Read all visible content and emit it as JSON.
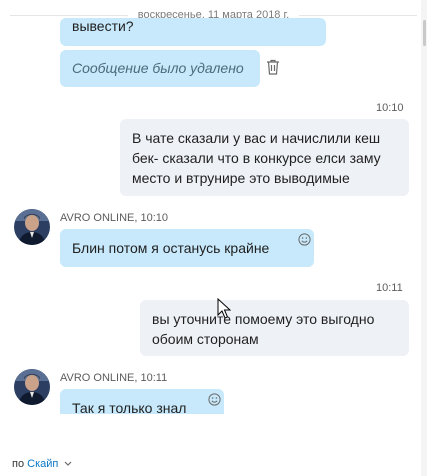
{
  "date_separator": "воскресенье, 11 марта 2018 г.",
  "messages": [
    {
      "text": "вывести?"
    },
    {
      "text": "Сообщение было удалено"
    },
    {
      "time": "10:10",
      "lines": [
        "В чате  сказали у вас и начислили кеш",
        "бек- сказали что в конкурсе елси заму",
        "место и втрунире это выводимые"
      ]
    },
    {
      "sender": "AVRO ONLINE, 10:10",
      "text": "Блин потом я останусь крайне"
    },
    {
      "time": "10:11",
      "lines": [
        "вы уточните помоему  это выгодно",
        "обоим сторонам"
      ]
    },
    {
      "sender": "AVRO ONLINE, 10:11",
      "text": "Так я только знал"
    }
  ],
  "footer": {
    "prefix": "по",
    "link": "Скайп"
  },
  "icons": {
    "emoji": "smiley-icon",
    "delete": "trash-icon",
    "chevron": "chevron-down-icon"
  },
  "colors": {
    "incoming": "#c7e9fb",
    "outgoing": "#eef1f6",
    "link": "#0a78c8"
  }
}
